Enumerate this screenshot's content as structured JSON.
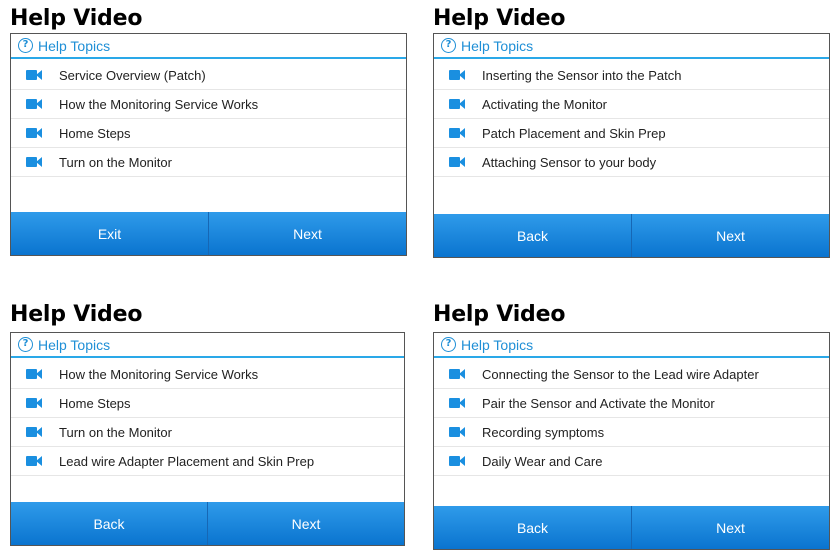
{
  "panels": [
    {
      "title": "Help Video",
      "topics_label": "Help Topics",
      "items": [
        "Service Overview (Patch)",
        "How the Monitoring Service Works",
        "Home Steps",
        "Turn on the Monitor"
      ],
      "left_button": "Exit",
      "right_button": "Next"
    },
    {
      "title": "Help Video",
      "topics_label": "Help Topics",
      "items": [
        "Inserting the Sensor into the Patch",
        "Activating the Monitor",
        "Patch Placement and Skin Prep",
        "Attaching Sensor to your body"
      ],
      "left_button": "Back",
      "right_button": "Next"
    },
    {
      "title": "Help Video",
      "topics_label": "Help Topics",
      "items": [
        "How the Monitoring Service Works",
        "Home Steps",
        "Turn on the Monitor",
        "Lead wire Adapter Placement and Skin Prep"
      ],
      "left_button": "Back",
      "right_button": "Next"
    },
    {
      "title": "Help Video",
      "topics_label": "Help Topics",
      "items": [
        "Connecting the Sensor to the Lead wire Adapter",
        "Pair the Sensor and Activate the Monitor",
        "Recording symptoms",
        "Daily Wear and Care"
      ],
      "left_button": "Back",
      "right_button": "Next"
    }
  ],
  "icons": {
    "help": "question-circle-icon",
    "item": "video-camera-icon"
  },
  "colors": {
    "accent": "#1f8fd6",
    "button_bar": "#1a86dd",
    "icon": "#1a8fe0"
  }
}
